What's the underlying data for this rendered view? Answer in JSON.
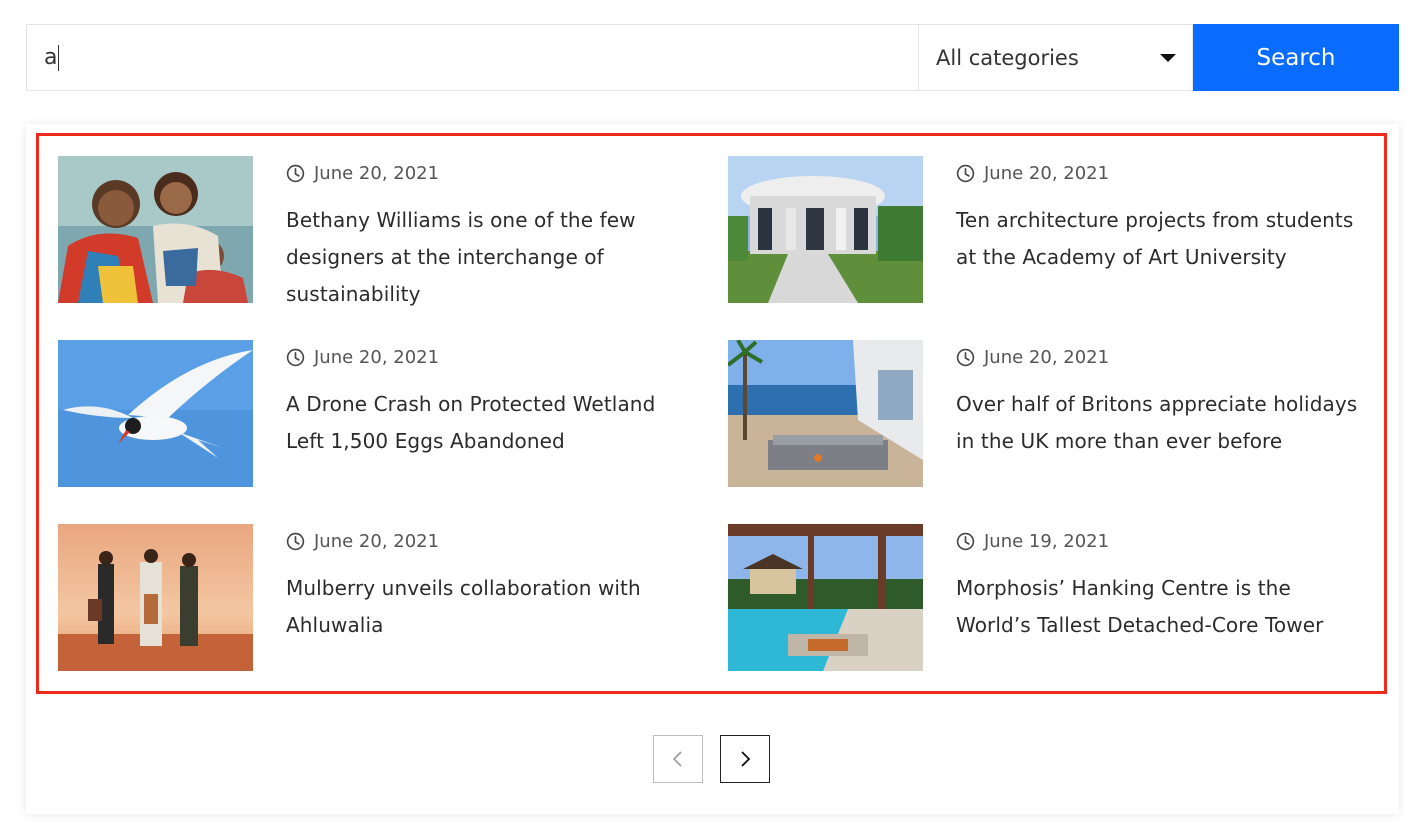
{
  "search": {
    "value": "a",
    "category_selected": "All categories",
    "button_label": "Search"
  },
  "results": [
    {
      "date": "June 20, 2021",
      "title": "Bethany Williams is one of the few designers at the interchange of sustainability",
      "image": "fashion-family-photo"
    },
    {
      "date": "June 20, 2021",
      "title": "Ten architecture projects from students at the Academy of Art University",
      "image": "modern-pavilion-photo"
    },
    {
      "date": "June 20, 2021",
      "title": "A Drone Crash on Protected Wetland Left 1,500 Eggs Abandoned",
      "image": "tern-bird-photo"
    },
    {
      "date": "June 20, 2021",
      "title": "Over half of Britons appreciate holidays in the UK more than ever before",
      "image": "seaside-terrace-photo"
    },
    {
      "date": "June 20, 2021",
      "title": "Mulberry unveils collaboration with Ahluwalia",
      "image": "fashion-models-sunset-photo"
    },
    {
      "date": "June 19, 2021",
      "title": "Morphosis’ Hanking Centre is the World’s Tallest Detached-Core Tower",
      "image": "resort-pool-photo"
    }
  ],
  "pagination": {
    "prev_icon": "chevron-left-icon",
    "next_icon": "chevron-right-icon"
  },
  "colors": {
    "accent": "#0a6cff",
    "highlight": "#ee2b1b"
  }
}
